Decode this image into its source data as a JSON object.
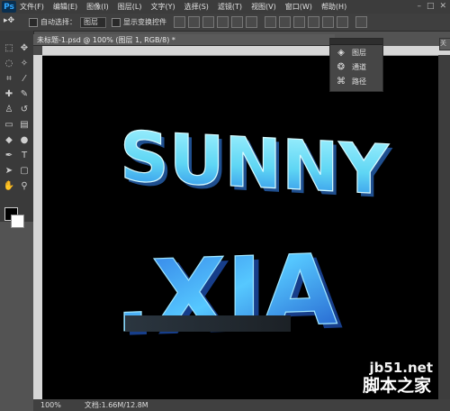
{
  "app": {
    "logo": "Ps"
  },
  "menu": [
    "文件(F)",
    "编辑(E)",
    "图像(I)",
    "图层(L)",
    "文字(Y)",
    "选择(S)",
    "滤镜(T)",
    "视图(V)",
    "窗口(W)",
    "帮助(H)"
  ],
  "window_controls": {
    "minimize": "–",
    "maximize": "□",
    "close": "✕"
  },
  "options": {
    "auto_select_label": "自动选择：",
    "auto_select_value": "图层",
    "show_transform_label": "显示变换控件"
  },
  "document": {
    "tab_title": "未标题-1.psd @ 100% (图层 1, RGB/8) *"
  },
  "panel": {
    "items": [
      {
        "label": "图层",
        "icon": "layers-icon"
      },
      {
        "label": "通道",
        "icon": "channels-icon"
      },
      {
        "label": "路径",
        "icon": "paths-icon"
      }
    ]
  },
  "right_strip": "关",
  "canvas_text": {
    "line1": "SUNNY",
    "line2": ".XIA"
  },
  "status": {
    "zoom": "100%",
    "doc_size": "文档:1.66M/12.8M"
  },
  "watermark": {
    "site": "jb51.net",
    "name": "脚本之家"
  },
  "colors": {
    "canvas": "#000000",
    "text_gradient_a": "#9ff2ff",
    "text_gradient_b": "#2a7de0"
  }
}
